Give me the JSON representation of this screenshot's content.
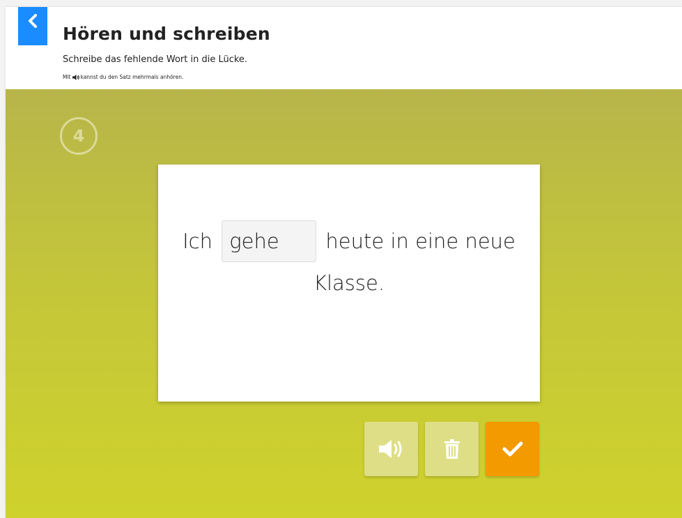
{
  "header": {
    "title": "Hören und schreiben",
    "subtitle": "Schreibe das fehlende Wort in die Lücke.",
    "hint_prefix": "Mit",
    "hint_suffix": "kannst du den Satz mehrmals anhören."
  },
  "exercise": {
    "step_number": "4",
    "sentence_before": "Ich",
    "gap_value": "gehe",
    "sentence_after": "heute in eine neue Klasse."
  },
  "actions": {
    "audio_icon": "speaker-icon",
    "trash_icon": "trash-icon",
    "check_icon": "check-icon"
  },
  "colors": {
    "back_button": "#1a8cff",
    "stage_top": "#b7b54a",
    "stage_bottom": "#cfd22c",
    "secondary_button": "#dede86",
    "primary_button": "#f29a00"
  }
}
